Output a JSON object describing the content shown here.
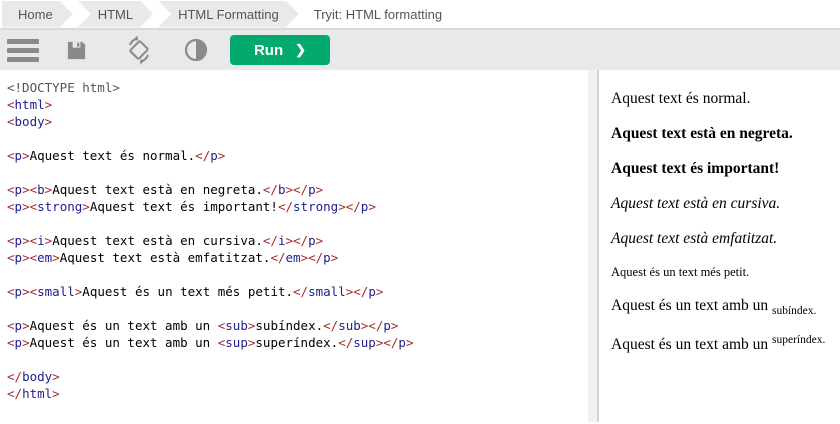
{
  "breadcrumb": {
    "items": [
      {
        "label": "Home"
      },
      {
        "label": "HTML"
      },
      {
        "label": "HTML Formatting"
      }
    ],
    "current": "Tryit: HTML formatting"
  },
  "toolbar": {
    "icons": [
      "menu-icon",
      "save-icon",
      "orientation-icon",
      "contrast-icon"
    ],
    "run_label": "Run",
    "run_chevron": "❯"
  },
  "colors": {
    "accent_green": "#04aa6d",
    "toolbar_bg": "#e7e9eb",
    "crumb_bg": "#e7e9eb",
    "divider": "#f1f1f1",
    "icon_gray": "#8a8a8a",
    "syntax_bracket": "#a52a2a",
    "syntax_tag": "#202090",
    "syntax_meta": "#555555"
  },
  "editor": {
    "lines": [
      [
        [
          "m",
          "<!DOCTYPE html>"
        ]
      ],
      [
        [
          "b",
          "<"
        ],
        [
          "t",
          "html"
        ],
        [
          "b",
          ">"
        ]
      ],
      [
        [
          "b",
          "<"
        ],
        [
          "t",
          "body"
        ],
        [
          "b",
          ">"
        ]
      ],
      [],
      [
        [
          "b",
          "<"
        ],
        [
          "t",
          "p"
        ],
        [
          "b",
          ">"
        ],
        [
          "x",
          "Aquest text és normal."
        ],
        [
          "b",
          "</"
        ],
        [
          "t",
          "p"
        ],
        [
          "b",
          ">"
        ]
      ],
      [],
      [
        [
          "b",
          "<"
        ],
        [
          "t",
          "p"
        ],
        [
          "b",
          ">"
        ],
        [
          "b",
          "<"
        ],
        [
          "t",
          "b"
        ],
        [
          "b",
          ">"
        ],
        [
          "x",
          "Aquest text està en negreta."
        ],
        [
          "b",
          "</"
        ],
        [
          "t",
          "b"
        ],
        [
          "b",
          ">"
        ],
        [
          "b",
          "</"
        ],
        [
          "t",
          "p"
        ],
        [
          "b",
          ">"
        ]
      ],
      [
        [
          "b",
          "<"
        ],
        [
          "t",
          "p"
        ],
        [
          "b",
          ">"
        ],
        [
          "b",
          "<"
        ],
        [
          "t",
          "strong"
        ],
        [
          "b",
          ">"
        ],
        [
          "x",
          "Aquest text és important!"
        ],
        [
          "b",
          "</"
        ],
        [
          "t",
          "strong"
        ],
        [
          "b",
          ">"
        ],
        [
          "b",
          "</"
        ],
        [
          "t",
          "p"
        ],
        [
          "b",
          ">"
        ]
      ],
      [],
      [
        [
          "b",
          "<"
        ],
        [
          "t",
          "p"
        ],
        [
          "b",
          ">"
        ],
        [
          "b",
          "<"
        ],
        [
          "t",
          "i"
        ],
        [
          "b",
          ">"
        ],
        [
          "x",
          "Aquest text està en cursiva."
        ],
        [
          "b",
          "</"
        ],
        [
          "t",
          "i"
        ],
        [
          "b",
          ">"
        ],
        [
          "b",
          "</"
        ],
        [
          "t",
          "p"
        ],
        [
          "b",
          ">"
        ]
      ],
      [
        [
          "b",
          "<"
        ],
        [
          "t",
          "p"
        ],
        [
          "b",
          ">"
        ],
        [
          "b",
          "<"
        ],
        [
          "t",
          "em"
        ],
        [
          "b",
          ">"
        ],
        [
          "x",
          "Aquest text està emfatitzat."
        ],
        [
          "b",
          "</"
        ],
        [
          "t",
          "em"
        ],
        [
          "b",
          ">"
        ],
        [
          "b",
          "</"
        ],
        [
          "t",
          "p"
        ],
        [
          "b",
          ">"
        ]
      ],
      [],
      [
        [
          "b",
          "<"
        ],
        [
          "t",
          "p"
        ],
        [
          "b",
          ">"
        ],
        [
          "b",
          "<"
        ],
        [
          "t",
          "small"
        ],
        [
          "b",
          ">"
        ],
        [
          "x",
          "Aquest és un text més petit."
        ],
        [
          "b",
          "</"
        ],
        [
          "t",
          "small"
        ],
        [
          "b",
          ">"
        ],
        [
          "b",
          "</"
        ],
        [
          "t",
          "p"
        ],
        [
          "b",
          ">"
        ]
      ],
      [],
      [
        [
          "b",
          "<"
        ],
        [
          "t",
          "p"
        ],
        [
          "b",
          ">"
        ],
        [
          "x",
          "Aquest és un text amb un "
        ],
        [
          "b",
          "<"
        ],
        [
          "t",
          "sub"
        ],
        [
          "b",
          ">"
        ],
        [
          "x",
          "subíndex."
        ],
        [
          "b",
          "</"
        ],
        [
          "t",
          "sub"
        ],
        [
          "b",
          ">"
        ],
        [
          "b",
          "</"
        ],
        [
          "t",
          "p"
        ],
        [
          "b",
          ">"
        ]
      ],
      [
        [
          "b",
          "<"
        ],
        [
          "t",
          "p"
        ],
        [
          "b",
          ">"
        ],
        [
          "x",
          "Aquest és un text amb un "
        ],
        [
          "b",
          "<"
        ],
        [
          "t",
          "sup"
        ],
        [
          "b",
          ">"
        ],
        [
          "x",
          "superíndex."
        ],
        [
          "b",
          "</"
        ],
        [
          "t",
          "sup"
        ],
        [
          "b",
          ">"
        ],
        [
          "b",
          "</"
        ],
        [
          "t",
          "p"
        ],
        [
          "b",
          ">"
        ]
      ],
      [],
      [
        [
          "b",
          "</"
        ],
        [
          "t",
          "body"
        ],
        [
          "b",
          ">"
        ]
      ],
      [
        [
          "b",
          "</"
        ],
        [
          "t",
          "html"
        ],
        [
          "b",
          ">"
        ]
      ]
    ]
  },
  "output": {
    "paragraphs": [
      {
        "style": "normal",
        "text": "Aquest text és normal."
      },
      {
        "style": "bold",
        "text": "Aquest text està en negreta."
      },
      {
        "style": "bold",
        "text": "Aquest text és important!"
      },
      {
        "style": "italic",
        "text": "Aquest text està en cursiva."
      },
      {
        "style": "italic",
        "text": "Aquest text està emfatitzat."
      },
      {
        "style": "small",
        "text": "Aquest és un text més petit."
      },
      {
        "style": "normal",
        "text": "Aquest és un text amb un ",
        "script": {
          "type": "sub",
          "text": "subíndex."
        }
      },
      {
        "style": "normal",
        "text": "Aquest és un text amb un ",
        "script": {
          "type": "sup",
          "text": "superíndex."
        }
      }
    ]
  }
}
